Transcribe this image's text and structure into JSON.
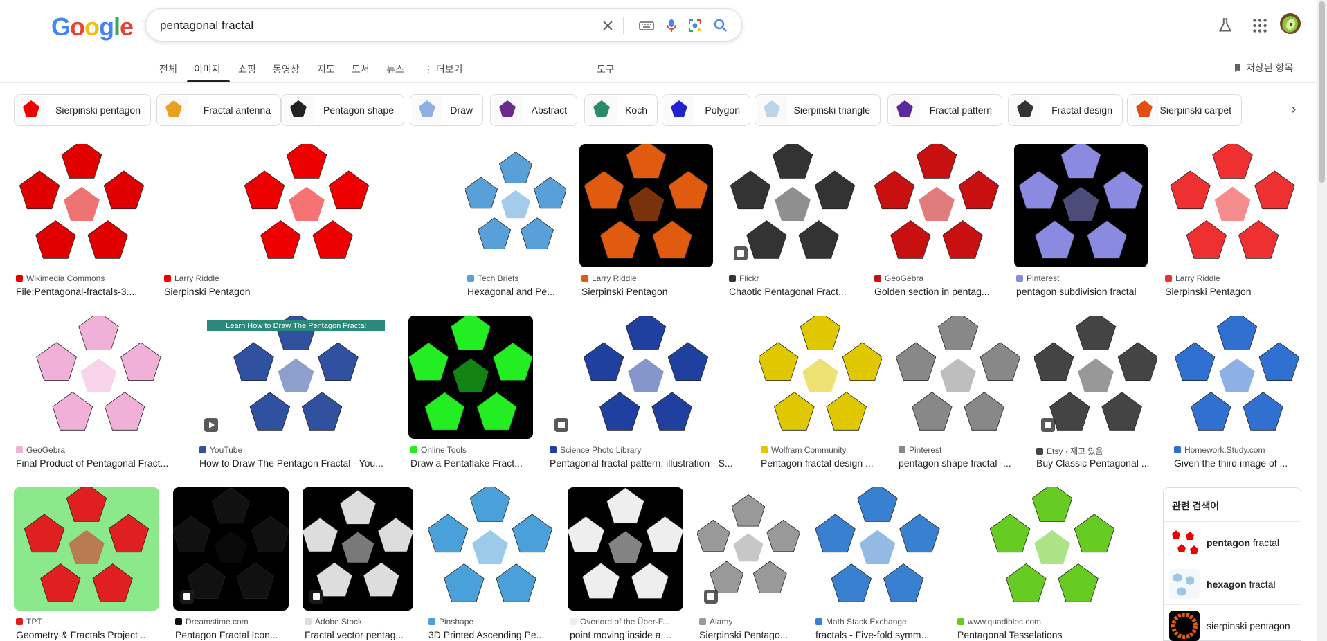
{
  "search": {
    "query": "pentagonal fractal"
  },
  "logo": {
    "letters": [
      "G",
      "o",
      "o",
      "g",
      "l",
      "e"
    ]
  },
  "tabs": [
    {
      "label": "전체"
    },
    {
      "label": "이미지"
    },
    {
      "label": "쇼핑"
    },
    {
      "label": "동영상"
    },
    {
      "label": "지도"
    },
    {
      "label": "도서"
    },
    {
      "label": "뉴스"
    },
    {
      "label": "더보기"
    }
  ],
  "tools_label": "도구",
  "saved_label": "저장된 항목",
  "chips": [
    {
      "label": "Sierpinski pentagon"
    },
    {
      "label": "Fractal antenna"
    },
    {
      "label": "Pentagon shape"
    },
    {
      "label": "Draw"
    },
    {
      "label": "Abstract"
    },
    {
      "label": "Koch"
    },
    {
      "label": "Polygon"
    },
    {
      "label": "Sierpinski triangle"
    },
    {
      "label": "Fractal pattern"
    },
    {
      "label": "Fractal design"
    },
    {
      "label": "Sierpinski carpet"
    }
  ],
  "results": [
    {
      "source": "Wikimedia Commons",
      "title": "File:Pentagonal-fractals-3....",
      "color": "#e00000"
    },
    {
      "source": "Larry Riddle",
      "title": "Sierpinski Pentagon",
      "color": "#ee0000"
    },
    {
      "source": "Tech Briefs",
      "title": "Hexagonal and Pe...",
      "color": "#5aa0d8"
    },
    {
      "source": "Larry Riddle",
      "title": "Sierpinski Pentagon",
      "color": "#e05a10"
    },
    {
      "source": "Flickr",
      "title": "Chaotic Pentagonal Fract...",
      "color": "#333333"
    },
    {
      "source": "GeoGebra",
      "title": "Golden section in pentag...",
      "color": "#c81010"
    },
    {
      "source": "Pinterest",
      "title": "pentagon subdivision fractal",
      "color": "#8a8ae0"
    },
    {
      "source": "Larry Riddle",
      "title": "Sierpinski Pentagon",
      "color": "#ee3030"
    },
    {
      "source": "GeoGebra",
      "title": "Final Product of Pentagonal Fract...",
      "color": "#f0b0d8"
    },
    {
      "source": "YouTube",
      "title": "How to Draw The Pentagon Fractal - You...",
      "color": "#3050a0",
      "banner": "Learn How to Draw The Pentagon Fractal"
    },
    {
      "source": "Online Tools",
      "title": "Draw a Pentaflake Fract...",
      "color": "#22ee22"
    },
    {
      "source": "Science Photo Library",
      "title": "Pentagonal fractal pattern, illustration - S...",
      "color": "#2040a0"
    },
    {
      "source": "Wolfram Community",
      "title": "Pentagon fractal design ...",
      "color": "#e0c800"
    },
    {
      "source": "Pinterest",
      "title": "pentagon shape fractal -...",
      "color": "#888888"
    },
    {
      "source": "Etsy · 재고 있음",
      "title": "Buy Classic Pentagonal ...",
      "color": "#444444"
    },
    {
      "source": "Homework.Study.com",
      "title": "Given the third image of ...",
      "color": "#3070d0"
    },
    {
      "source": "TPT",
      "title": "Geometry & Fractals Project ...",
      "color": "#e02020"
    },
    {
      "source": "Dreamstime.com",
      "title": "Pentagon Fractal Icon...",
      "color": "#111111"
    },
    {
      "source": "Adobe Stock",
      "title": "Fractal vector pentag...",
      "color": "#dddddd"
    },
    {
      "source": "Pinshape",
      "title": "3D Printed Ascending Pe...",
      "color": "#4aa0d8"
    },
    {
      "source": "Overlord of the Über-F...",
      "title": "point moving inside a ...",
      "color": "#eeeeee"
    },
    {
      "source": "Alamy",
      "title": "Sierpinski Pentago...",
      "color": "#999999"
    },
    {
      "source": "Math Stack Exchange",
      "title": "fractals - Five-fold symm...",
      "color": "#3a80d0"
    },
    {
      "source": "www.quadibloc.com",
      "title": "Pentagonal Tesselations",
      "color": "#66cc22"
    }
  ],
  "related": {
    "heading": "관련 검색어",
    "items": [
      {
        "bold": "pentagon",
        "rest": " fractal"
      },
      {
        "bold": "hexagon",
        "rest": " fractal"
      },
      {
        "bold": "",
        "rest": "sierpinski pentagon"
      }
    ]
  },
  "colors": {
    "blue": "#4285f4",
    "red": "#ea4335",
    "yellow": "#fbbc05",
    "green": "#34a853"
  }
}
